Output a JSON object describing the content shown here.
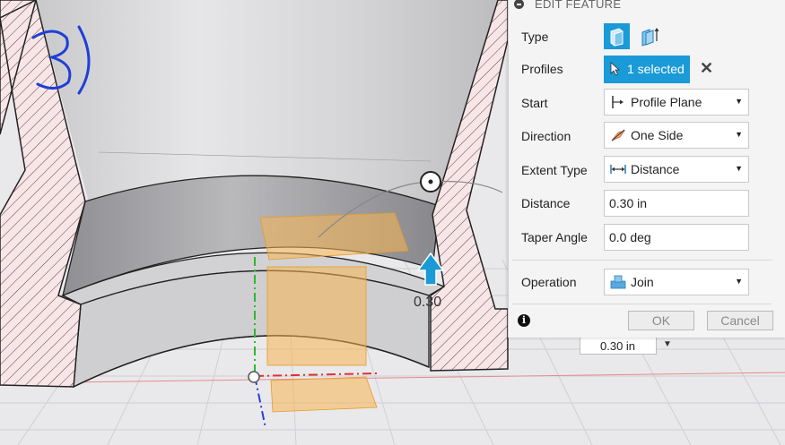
{
  "canvas": {
    "annotation": "3)",
    "dimension_value": "0.30 in",
    "label": "0.30"
  },
  "panel": {
    "title": "EDIT FEATURE",
    "rows": {
      "type_label": "Type",
      "profiles_label": "Profiles",
      "profiles_value": "1 selected",
      "start_label": "Start",
      "start_value": "Profile Plane",
      "direction_label": "Direction",
      "direction_value": "One Side",
      "extent_label": "Extent Type",
      "extent_value": "Distance",
      "distance_label": "Distance",
      "distance_value": "0.30 in",
      "taper_label": "Taper Angle",
      "taper_value": "0.0 deg",
      "operation_label": "Operation",
      "operation_value": "Join"
    },
    "ok_label": "OK",
    "cancel_label": "Cancel"
  },
  "colors": {
    "accent": "#1a9ad6",
    "annotation_ink": "#1f3fd6",
    "section_hatch": "#c0392b",
    "profile_fill": "#f7b550"
  },
  "icons": [
    "collapse-icon",
    "extrude-solid-icon",
    "extrude-surface-icon",
    "cursor-icon",
    "close-icon",
    "profile-plane-icon",
    "one-side-icon",
    "distance-icon",
    "join-icon",
    "info-icon",
    "drag-arrow-icon",
    "dropdown-arrow-icon"
  ]
}
